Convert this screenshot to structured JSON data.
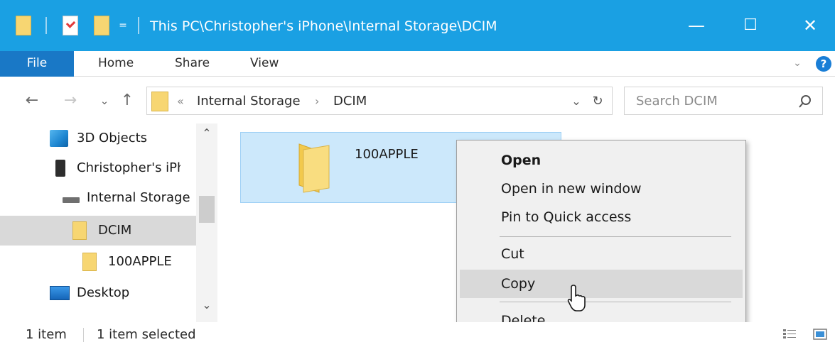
{
  "titlebar": {
    "title": "This PC\\Christopher's iPhone\\Internal Storage\\DCIM",
    "qa_arrow": "=",
    "minimize": "—",
    "maximize": "☐",
    "close": "✕"
  },
  "ribbon": {
    "tabs": [
      {
        "label": "File"
      },
      {
        "label": "Home"
      },
      {
        "label": "Share"
      },
      {
        "label": "View"
      }
    ],
    "expand": "⌄",
    "help": "?"
  },
  "nav": {
    "back": "←",
    "forward": "→",
    "recent": "⌄",
    "up": "↑",
    "address": {
      "overflow": "«",
      "segments": [
        "Internal Storage",
        "DCIM"
      ],
      "separator": "›",
      "dropdown": "⌄",
      "refresh": "↻"
    },
    "search": {
      "placeholder": "Search DCIM"
    }
  },
  "navpane": {
    "items": [
      {
        "label": "3D Objects",
        "icon": "3d-objects-icon"
      },
      {
        "label": "Christopher's iPhone",
        "icon": "phone-icon"
      },
      {
        "label": "Internal Storage",
        "icon": "drive-icon"
      },
      {
        "label": "DCIM",
        "icon": "folder-icon",
        "selected": true
      },
      {
        "label": "100APPLE",
        "icon": "folder-icon"
      },
      {
        "label": "Desktop",
        "icon": "desktop-icon"
      }
    ],
    "scroll_up": "⌃",
    "scroll_down": "⌄"
  },
  "content": {
    "items": [
      {
        "label": "100APPLE",
        "icon": "folder-icon",
        "selected": true
      }
    ]
  },
  "context_menu": {
    "items": [
      {
        "label": "Open",
        "bold": true
      },
      {
        "label": "Open in new window"
      },
      {
        "label": "Pin to Quick access"
      },
      {
        "label": "Cut"
      },
      {
        "label": "Copy",
        "hover": true
      },
      {
        "label": "Delete"
      }
    ]
  },
  "status": {
    "count": "1 item",
    "selection": "1 item selected"
  },
  "colors": {
    "titlebar": "#1aa0e3",
    "file_tab": "#1978c6",
    "selection": "#cce8fb",
    "folder": "#f7d672"
  }
}
